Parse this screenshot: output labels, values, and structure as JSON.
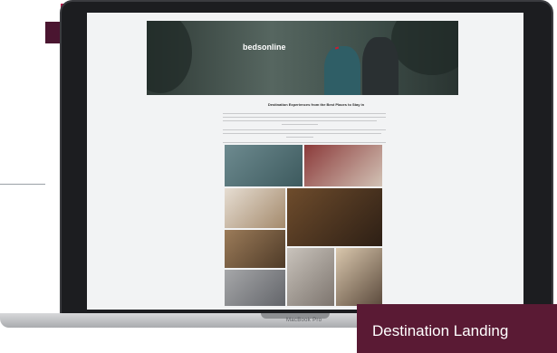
{
  "site": {
    "logo_text": "bedsonline",
    "badge_text": "",
    "page_title": "Destination Experiences from the Best Places to Stay in"
  },
  "device": {
    "model_label": "MacBook Pro"
  },
  "gallery": {
    "tiles": [
      {
        "name": "pool-resort",
        "color_a": "#6d8a8f",
        "color_b": "#3d5a5e"
      },
      {
        "name": "hotel-bedroom-red",
        "color_a": "#8b3a3a",
        "color_b": "#d2c2b5"
      },
      {
        "name": "bright-suite",
        "color_a": "#e6ddd2",
        "color_b": "#a48a6c"
      },
      {
        "name": "lounge-bar",
        "color_a": "#6e4c2c",
        "color_b": "#2d1f15"
      },
      {
        "name": "classic-room",
        "color_a": "#9b7b59",
        "color_b": "#4f3b28"
      },
      {
        "name": "twin-room",
        "color_a": "#c9c3bc",
        "color_b": "#7d756e"
      },
      {
        "name": "modern-room",
        "color_a": "#d9c7ad",
        "color_b": "#5b4a3c"
      },
      {
        "name": "terrace",
        "color_a": "#a6a7a9",
        "color_b": "#63656a"
      },
      {
        "name": "red-suite",
        "color_a": "#a33d3d",
        "color_b": "#3c2b26"
      }
    ]
  },
  "banner": {
    "text": "Destination Landing"
  },
  "colors": {
    "brand_primary": "#6b1d3c",
    "brand_accent": "#b5174a",
    "banner_bg": "#5a1a34"
  }
}
